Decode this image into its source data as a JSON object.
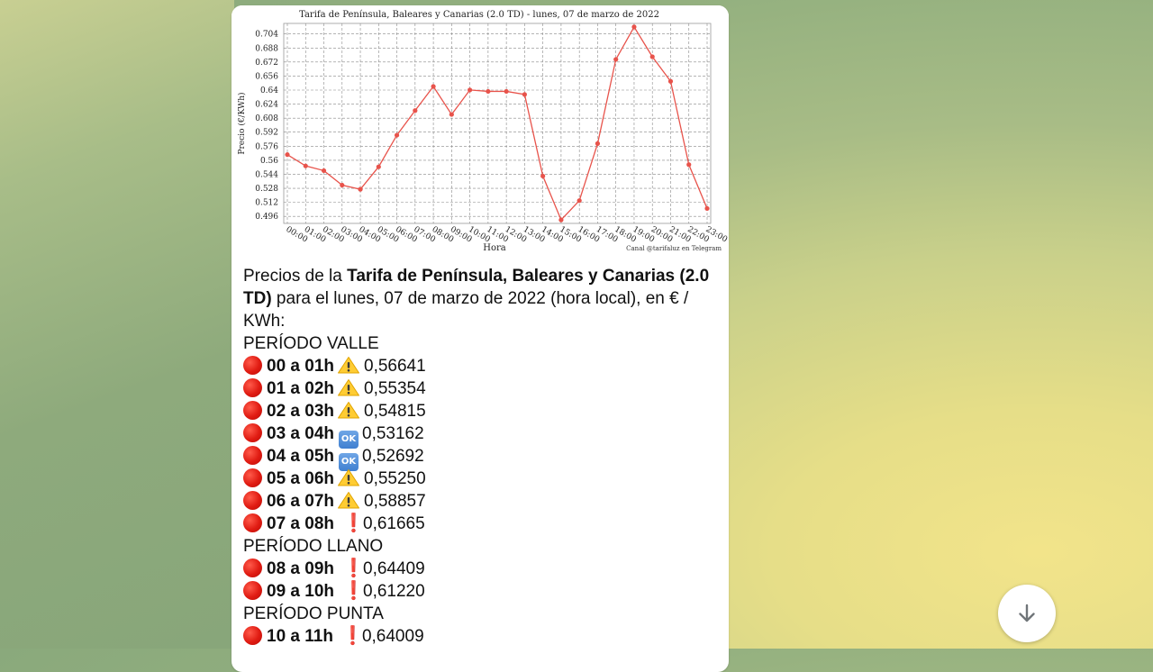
{
  "chart_data": {
    "type": "line",
    "title": "Tarifa de Península, Baleares y Canarias (2.0 TD) - lunes, 07 de marzo de 2022",
    "xlabel": "Hora",
    "ylabel": "Precio (€/KWh)",
    "watermark": "Canal @tarifaluz en Telegram",
    "categories": [
      "00:00",
      "01:00",
      "02:00",
      "03:00",
      "04:00",
      "05:00",
      "06:00",
      "07:00",
      "08:00",
      "09:00",
      "10:00",
      "11:00",
      "12:00",
      "13:00",
      "14:00",
      "15:00",
      "16:00",
      "17:00",
      "18:00",
      "19:00",
      "20:00",
      "21:00",
      "22:00",
      "23:00"
    ],
    "values": [
      0.56641,
      0.55354,
      0.54815,
      0.53162,
      0.52692,
      0.5525,
      0.58857,
      0.61665,
      0.64409,
      0.6122,
      0.64009,
      0.6385,
      0.6385,
      0.635,
      0.542,
      0.492,
      0.514,
      0.579,
      0.675,
      0.712,
      0.678,
      0.65,
      0.555,
      0.505
    ],
    "yticks": [
      "0.496",
      "0.512",
      "0.528",
      "0.544",
      "0.56",
      "0.576",
      "0.592",
      "0.608",
      "0.624",
      "0.64",
      "0.656",
      "0.672",
      "0.688",
      "0.704"
    ],
    "ylim": [
      0.488,
      0.716
    ],
    "grid": true,
    "color": "#e8534b"
  },
  "caption": {
    "intro_prefix": "Precios de la ",
    "intro_bold1": "Tarifa de Península, Baleares y Canarias",
    "intro_bold2": "(2.0 TD)",
    "intro_suffix": " para el lunes, 07 de marzo de 2022 (hora local), en € / KWh:",
    "period_valle": "PERÍODO VALLE",
    "period_llano": "PERÍODO LLANO",
    "period_punta": "PERÍODO PUNTA"
  },
  "rows": [
    {
      "range": "00 a 01h",
      "icon": "warning-icon",
      "value": "0,56641"
    },
    {
      "range": "01 a 02h",
      "icon": "warning-icon",
      "value": "0,55354"
    },
    {
      "range": "02 a 03h",
      "icon": "warning-icon",
      "value": "0,54815"
    },
    {
      "range": "03 a 04h",
      "icon": "ok-icon",
      "icon_text": "OK",
      "value": "0,53162"
    },
    {
      "range": "04 a 05h",
      "icon": "ok-icon",
      "icon_text": "OK",
      "value": "0,52692"
    },
    {
      "range": "05 a 06h",
      "icon": "warning-icon",
      "value": "0,55250"
    },
    {
      "range": "06 a 07h",
      "icon": "warning-icon",
      "value": "0,58857"
    },
    {
      "range": "07 a 08h",
      "icon": "exclamation-icon",
      "icon_text": "❗",
      "value": "0,61665"
    },
    {
      "range": "08 a 09h",
      "icon": "exclamation-icon",
      "icon_text": "❗",
      "value": "0,64409"
    },
    {
      "range": "09 a 10h",
      "icon": "exclamation-icon",
      "icon_text": "❗",
      "value": "0,61220"
    },
    {
      "range": "10 a 11h",
      "icon": "exclamation-icon",
      "icon_text": "❗",
      "value": "0,64009"
    }
  ],
  "scroll_button": {
    "icon": "arrow-down-icon"
  }
}
